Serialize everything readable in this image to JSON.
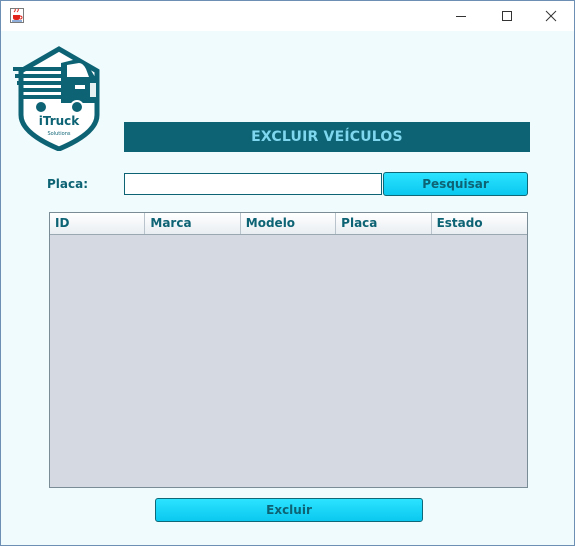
{
  "window": {
    "title": "",
    "app_icon": "java-coffee-icon",
    "controls": [
      "minimize-icon",
      "maximize-icon",
      "close-icon"
    ]
  },
  "logo": {
    "brand": "iTruck",
    "tagline": "Solutions",
    "icon": "truck-shield-logo"
  },
  "header": {
    "title": "EXCLUIR VEÍCULOS"
  },
  "search": {
    "label": "Placa:",
    "value": "",
    "button_label": "Pesquisar"
  },
  "table": {
    "columns": [
      "ID",
      "Marca",
      "Modelo",
      "Placa",
      "Estado"
    ],
    "rows": []
  },
  "actions": {
    "delete_label": "Excluir"
  },
  "colors": {
    "primary": "#0d6374",
    "accent": "#1dd3f7",
    "background": "#f0fbfd",
    "table_bg": "#d5d9e1"
  }
}
